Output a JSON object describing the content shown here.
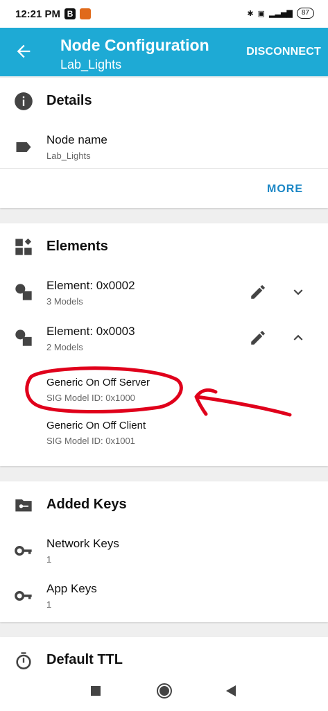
{
  "status": {
    "time": "12:21 PM",
    "badge1": "B",
    "battery": "87"
  },
  "appbar": {
    "title": "Node Configuration",
    "subtitle": "Lab_Lights",
    "action": "DISCONNECT"
  },
  "details": {
    "title": "Details",
    "node_name_label": "Node name",
    "node_name_value": "Lab_Lights",
    "more": "MORE"
  },
  "elements": {
    "title": "Elements",
    "items": [
      {
        "name": "Element: 0x0002",
        "sub": "3 Models",
        "expanded": false
      },
      {
        "name": "Element: 0x0003",
        "sub": "2 Models",
        "expanded": true
      }
    ],
    "models": [
      {
        "name": "Generic On Off Server",
        "id": "SIG Model ID: 0x1000"
      },
      {
        "name": "Generic On Off Client",
        "id": "SIG Model ID: 0x1001"
      }
    ]
  },
  "keys": {
    "title": "Added Keys",
    "items": [
      {
        "name": "Network Keys",
        "count": "1"
      },
      {
        "name": "App Keys",
        "count": "1"
      }
    ]
  },
  "ttl": {
    "title": "Default TTL"
  },
  "colors": {
    "accent": "#1eaad5",
    "link": "#1a86c5",
    "annotation": "#e0001b"
  }
}
